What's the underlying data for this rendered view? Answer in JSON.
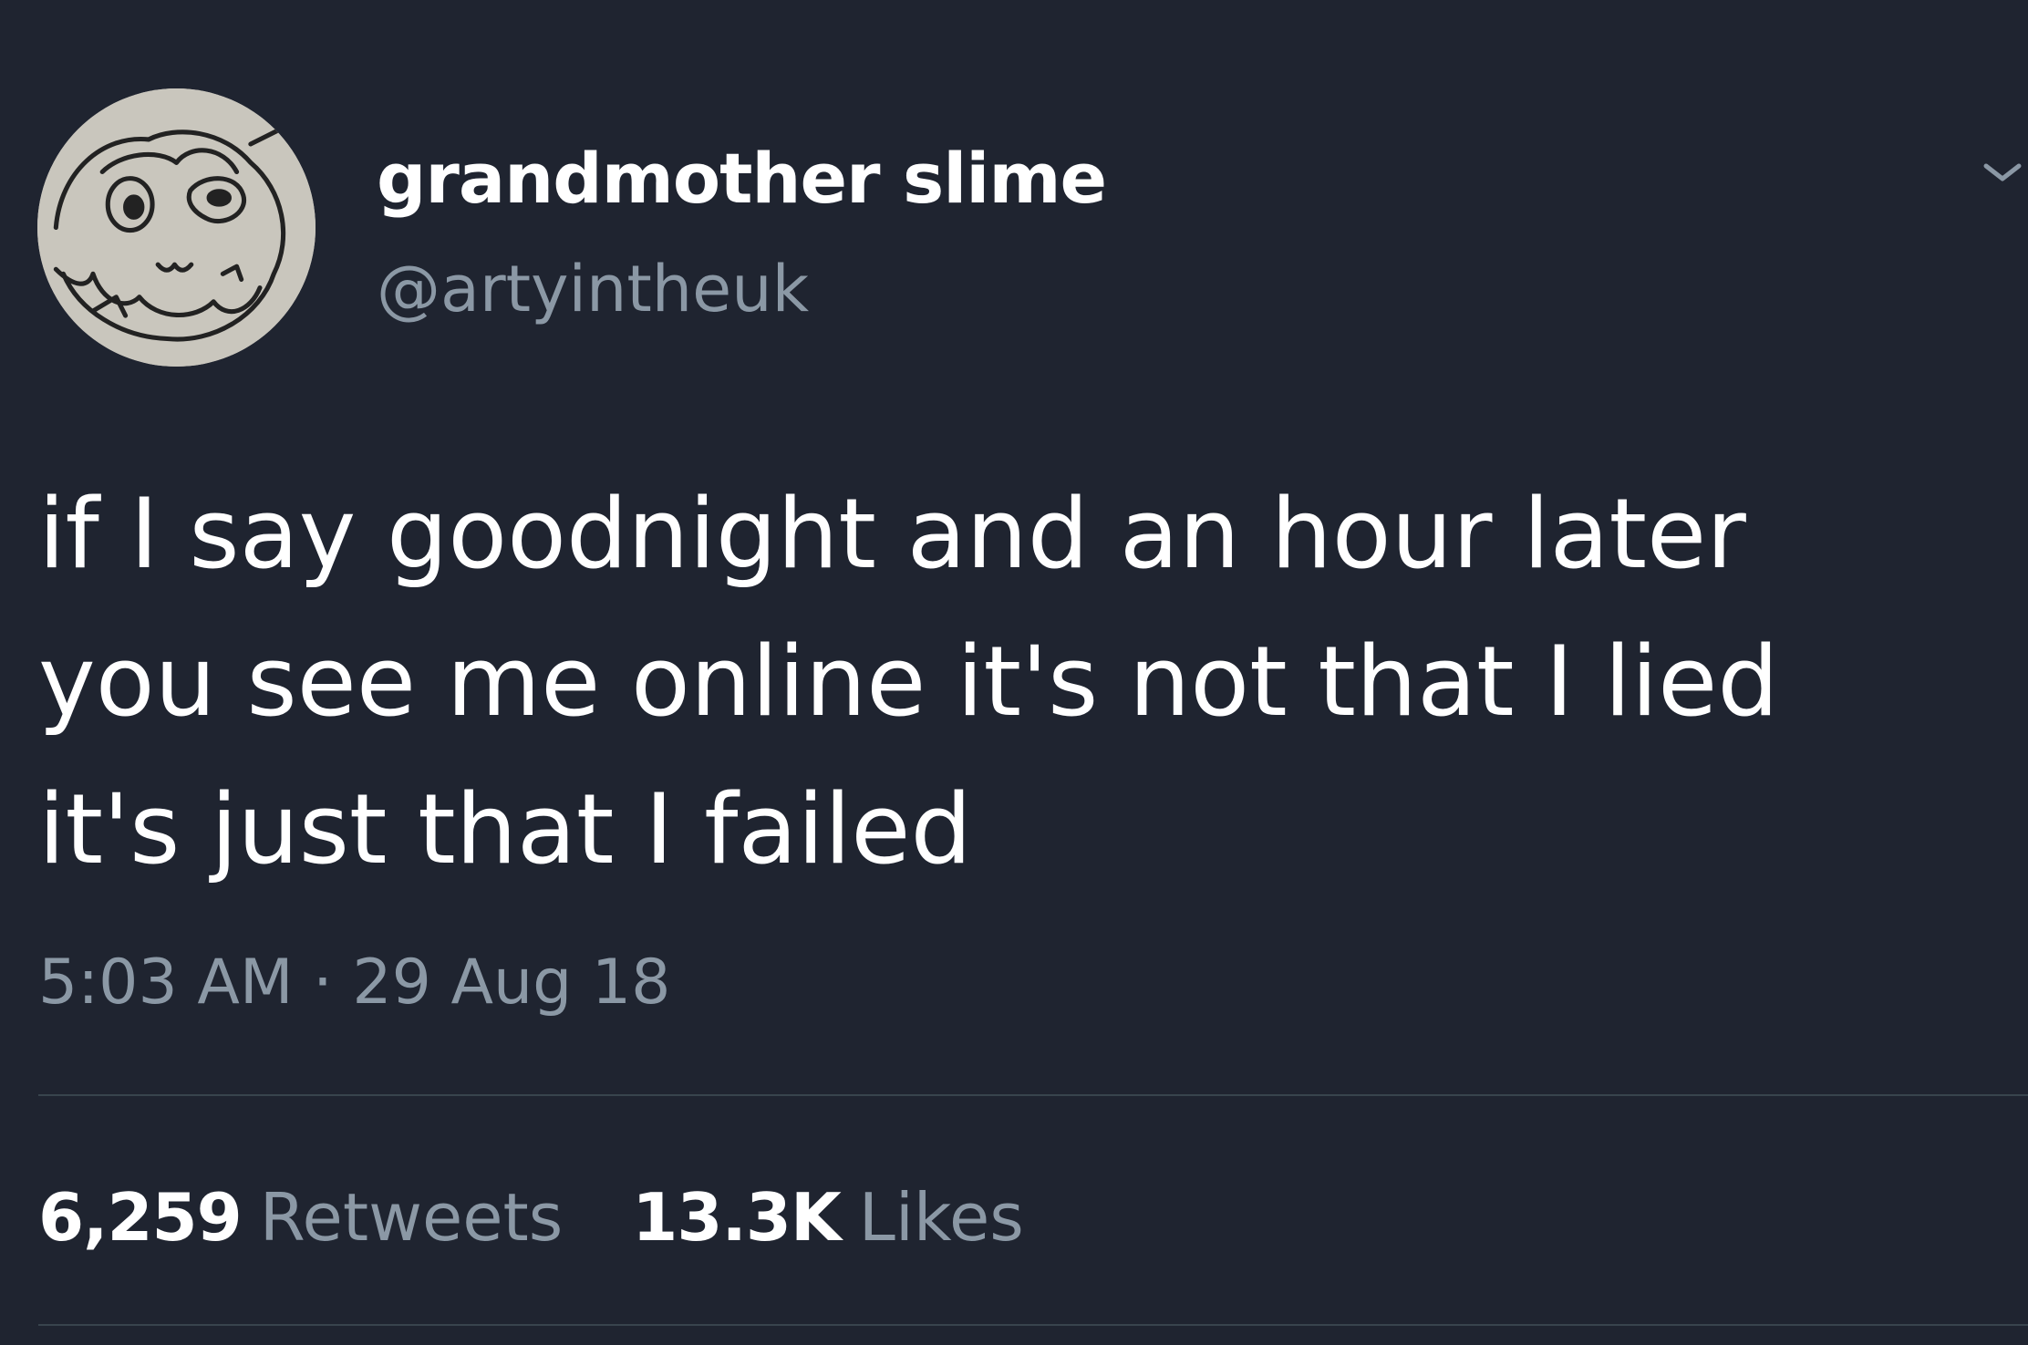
{
  "author": {
    "display_name": "grandmother slime",
    "handle": "@artyintheuk",
    "avatar_icon": "hand-drawn-creature-avatar"
  },
  "menu_icon": "chevron-down-icon",
  "tweet": {
    "text_lines": [
      "if I say goodnight and an hour later",
      "you see me online it's not that I lied",
      "it's just that I failed"
    ],
    "timestamp": "5:03 AM · 29 Aug 18"
  },
  "stats": {
    "retweets_count": "6,259",
    "retweets_label": "Retweets",
    "likes_count": "13.3K",
    "likes_label": "Likes"
  },
  "colors": {
    "background": "#1f2430",
    "primary_text": "#ffffff",
    "secondary_text": "#8b98a5",
    "divider": "#38444d"
  }
}
